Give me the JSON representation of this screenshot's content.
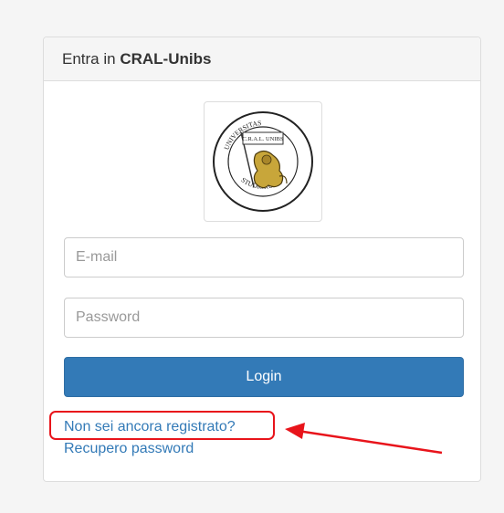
{
  "panel": {
    "heading_prefix": "Entra in ",
    "heading_brand": "CRAL-Unibs"
  },
  "logo": {
    "ring_text_top": "C.R.A.L. UNIBS",
    "ring_text_left": "UNIVERSITAS",
    "ring_text_bottom": "STUDIORUM",
    "ring_text_right": "BRIXIAE",
    "emblem": "lion-with-banner"
  },
  "form": {
    "email_placeholder": "E-mail",
    "password_placeholder": "Password",
    "login_label": "Login"
  },
  "links": {
    "register": "Non sei ancora registrato?",
    "recover": "Recupero password"
  },
  "annotation": {
    "color": "#e8141b"
  },
  "colors": {
    "primary": "#337ab7",
    "link": "#337ab7",
    "panel_border": "#dddddd"
  }
}
